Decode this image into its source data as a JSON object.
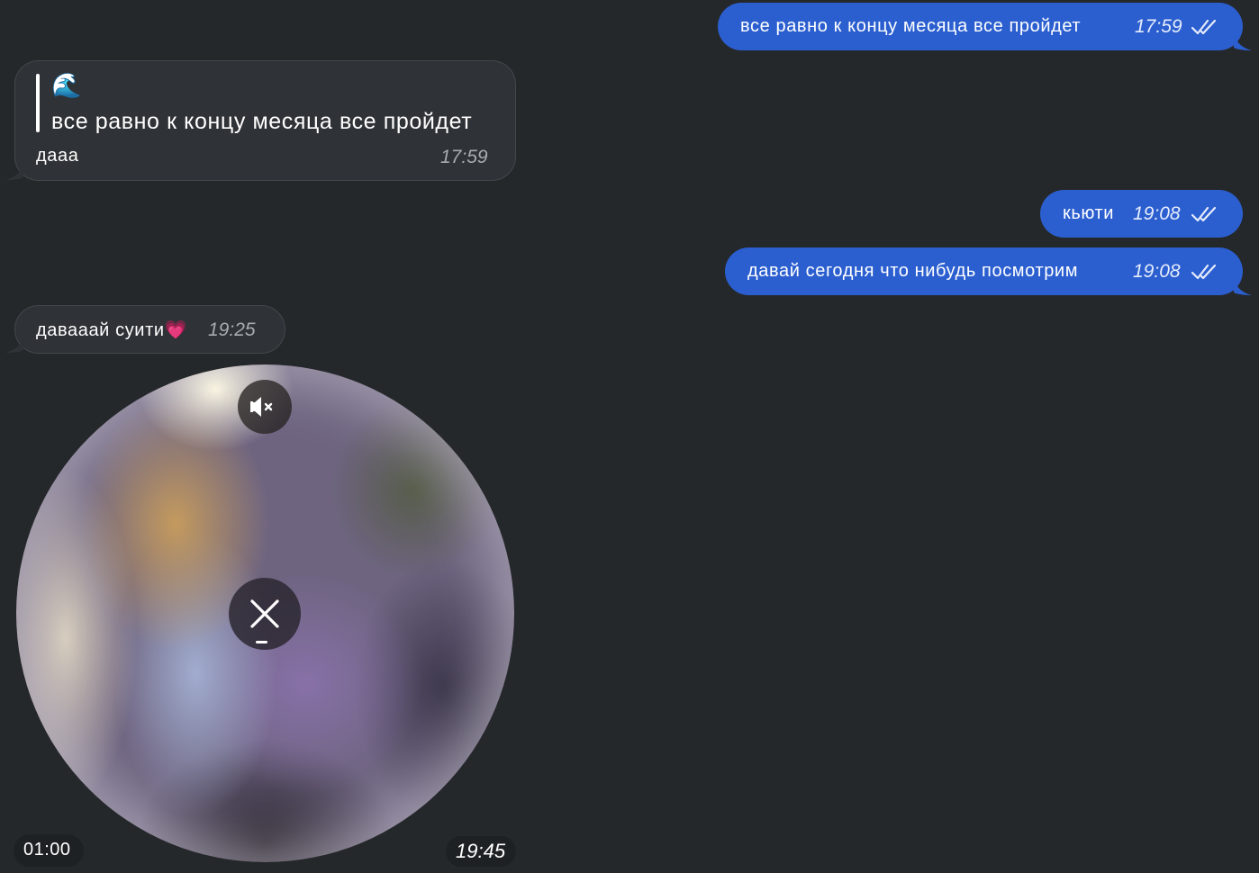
{
  "messages": {
    "m1": {
      "text": "все равно к концу месяца все пройдет",
      "time": "17:59",
      "status": "read-double-check"
    },
    "m2": {
      "reply_emoji": "🌊",
      "reply_text": "все равно к концу месяца все пройдет",
      "text": "дааа",
      "time": "17:59"
    },
    "m3": {
      "text": "кьюти",
      "time": "19:08",
      "status": "read-double-check"
    },
    "m4": {
      "text": "давай сегодня что нибудь посмотрим",
      "time": "19:08",
      "status": "read-double-check"
    },
    "m5": {
      "text": "давааай суити💗",
      "time": "19:25"
    }
  },
  "video_message": {
    "duration": "01:00",
    "time": "19:45",
    "mute_icon": "speaker-muted-icon",
    "close_icon": "close-icon"
  },
  "colors": {
    "background": "#25282b",
    "outgoing_bubble": "#2b5fd0",
    "incoming_bubble": "#2f3236"
  }
}
